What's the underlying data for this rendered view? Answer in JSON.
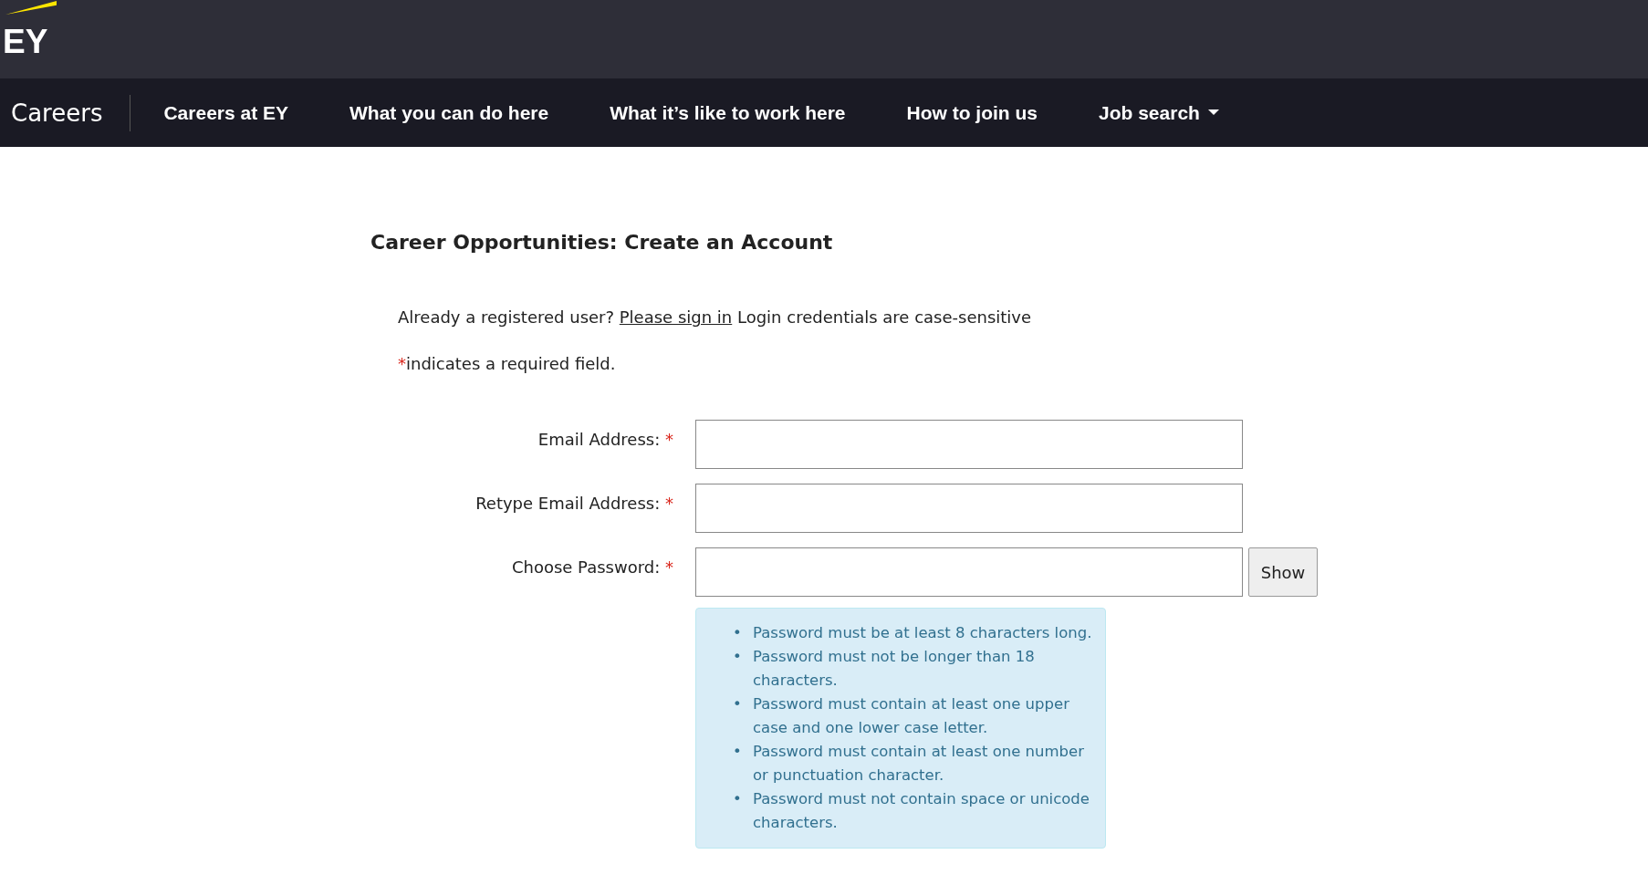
{
  "header": {
    "logo": "EY"
  },
  "nav": {
    "brand": "Careers",
    "items": [
      {
        "label": "Careers at EY",
        "kind": "link"
      },
      {
        "label": "What you can do here",
        "kind": "link"
      },
      {
        "label": "What it’s like to work here",
        "kind": "link"
      },
      {
        "label": "How to join us",
        "kind": "link"
      },
      {
        "label": "Job search",
        "kind": "dropdown"
      }
    ]
  },
  "page": {
    "title": "Career Opportunities: Create an Account",
    "signin": {
      "before": "Already a registered user?",
      "link": "Please sign in",
      "after": "Login credentials are case-sensitive"
    },
    "required_note": {
      "mark": "*",
      "text": "indicates a required field."
    },
    "fields": [
      {
        "label": "Email Address:",
        "mark": "*"
      },
      {
        "label": "Retype Email Address:",
        "mark": "*"
      },
      {
        "label": "Choose Password:",
        "mark": "*",
        "button": "Show"
      }
    ],
    "password_rules": [
      {
        "bullet": "•",
        "text": "Password must be at least 8 characters long."
      },
      {
        "bullet": "•",
        "text": "Password must not be longer than 18 characters."
      },
      {
        "bullet": "•",
        "text": "Password must contain at least one upper case and one lower case letter."
      },
      {
        "bullet": "•",
        "text": "Password must contain at least one number or punctuation character."
      },
      {
        "bullet": "•",
        "text": "Password must not contain space or unicode characters."
      }
    ]
  }
}
